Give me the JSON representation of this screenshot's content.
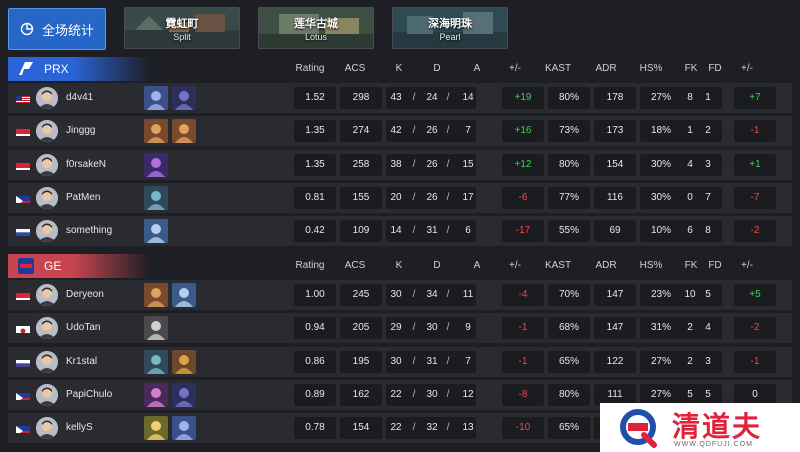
{
  "overview_button": {
    "label": "全场统计",
    "icon": "pie-chart-icon"
  },
  "map_tabs": [
    {
      "name_zh": "霓虹町",
      "name_en": "Split"
    },
    {
      "name_zh": "莲华古城",
      "name_en": "Lotus"
    },
    {
      "name_zh": "深海明珠",
      "name_en": "Pearl"
    }
  ],
  "columns": [
    "Rating",
    "ACS",
    "K",
    "D",
    "A",
    "+/-",
    "KAST",
    "ADR",
    "HS%",
    "FK",
    "FD",
    "+/-"
  ],
  "teams": [
    {
      "name": "PRX",
      "color": "#2b64d8",
      "players": [
        {
          "flag": "us",
          "name": "d4v41",
          "agents": [
            "sova",
            "omen"
          ],
          "rating": "1.52",
          "acs": "298",
          "k": "43",
          "d": "24",
          "a": "14",
          "diff": "+19",
          "kast": "80%",
          "adr": "178",
          "hs": "27%",
          "fk": "8",
          "fd": "1",
          "fdiff": "+7"
        },
        {
          "flag": "sg",
          "name": "Jinggg",
          "agents": [
            "raze",
            "raze"
          ],
          "rating": "1.35",
          "acs": "274",
          "k": "42",
          "d": "26",
          "a": "7",
          "diff": "+16",
          "kast": "73%",
          "adr": "173",
          "hs": "18%",
          "fk": "1",
          "fd": "2",
          "fdiff": "-1"
        },
        {
          "flag": "id",
          "name": "f0rsakeN",
          "agents": [
            "reyna"
          ],
          "rating": "1.35",
          "acs": "258",
          "k": "38",
          "d": "26",
          "a": "15",
          "diff": "+12",
          "kast": "80%",
          "adr": "154",
          "hs": "30%",
          "fk": "4",
          "fd": "3",
          "fdiff": "+1"
        },
        {
          "flag": "ph",
          "name": "PatMen",
          "agents": [
            "harbor"
          ],
          "rating": "0.81",
          "acs": "155",
          "k": "20",
          "d": "26",
          "a": "17",
          "diff": "-6",
          "kast": "77%",
          "adr": "116",
          "hs": "30%",
          "fk": "0",
          "fd": "7",
          "fdiff": "-7"
        },
        {
          "flag": "ru",
          "name": "something",
          "agents": [
            "jett"
          ],
          "rating": "0.42",
          "acs": "109",
          "k": "14",
          "d": "31",
          "a": "6",
          "diff": "-17",
          "kast": "55%",
          "adr": "69",
          "hs": "10%",
          "fk": "6",
          "fd": "8",
          "fdiff": "-2"
        }
      ]
    },
    {
      "name": "GE",
      "color": "#c8454f",
      "players": [
        {
          "flag": "sg",
          "name": "Deryeon",
          "agents": [
            "raze",
            "jett"
          ],
          "rating": "1.00",
          "acs": "245",
          "k": "30",
          "d": "34",
          "a": "11",
          "diff": "-4",
          "kast": "70%",
          "adr": "147",
          "hs": "23%",
          "fk": "10",
          "fd": "5",
          "fdiff": "+5"
        },
        {
          "flag": "kr",
          "name": "UdoTan",
          "agents": [
            "cypher"
          ],
          "rating": "0.94",
          "acs": "205",
          "k": "29",
          "d": "30",
          "a": "9",
          "diff": "-1",
          "kast": "68%",
          "adr": "147",
          "hs": "31%",
          "fk": "2",
          "fd": "4",
          "fdiff": "-2"
        },
        {
          "flag": "ru",
          "name": "Kr1stal",
          "agents": [
            "harbor",
            "breach"
          ],
          "rating": "0.86",
          "acs": "195",
          "k": "30",
          "d": "31",
          "a": "7",
          "diff": "-1",
          "kast": "65%",
          "adr": "122",
          "hs": "27%",
          "fk": "2",
          "fd": "3",
          "fdiff": "-1"
        },
        {
          "flag": "ph",
          "name": "PapiChulo",
          "agents": [
            "astra",
            "omen"
          ],
          "rating": "0.89",
          "acs": "162",
          "k": "22",
          "d": "30",
          "a": "12",
          "diff": "-8",
          "kast": "80%",
          "adr": "111",
          "hs": "27%",
          "fk": "5",
          "fd": "5",
          "fdiff": "0"
        },
        {
          "flag": "ph",
          "name": "kellyS",
          "agents": [
            "killjoy",
            "sova"
          ],
          "rating": "0.78",
          "acs": "154",
          "k": "22",
          "d": "32",
          "a": "13",
          "diff": "-10",
          "kast": "65%",
          "adr": "",
          "hs": "",
          "fk": "",
          "fd": "",
          "fdiff": ""
        }
      ]
    }
  ],
  "watermark": {
    "text": "清道夫",
    "url": "WWW.QDFUJI.COM"
  }
}
